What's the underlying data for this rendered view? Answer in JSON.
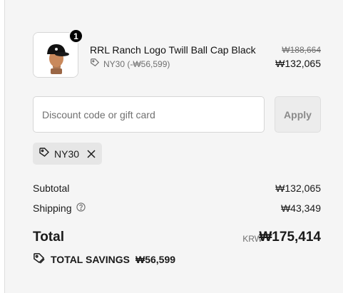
{
  "product": {
    "quantity": "1",
    "name": "RRL Ranch Logo Twill Ball Cap Black",
    "discount_label": "NY30 (-₩56,599)",
    "price_original": "₩188,664",
    "price_final": "₩132,065"
  },
  "discount": {
    "placeholder": "Discount code or gift card",
    "apply_label": "Apply",
    "applied_code": "NY30"
  },
  "summary": {
    "subtotal_label": "Subtotal",
    "subtotal_value": "₩132,065",
    "shipping_label": "Shipping",
    "shipping_value": "₩43,349",
    "total_label": "Total",
    "currency": "KRW",
    "total_value": "₩175,414",
    "savings_label": "TOTAL SAVINGS",
    "savings_value": "₩56,599"
  }
}
